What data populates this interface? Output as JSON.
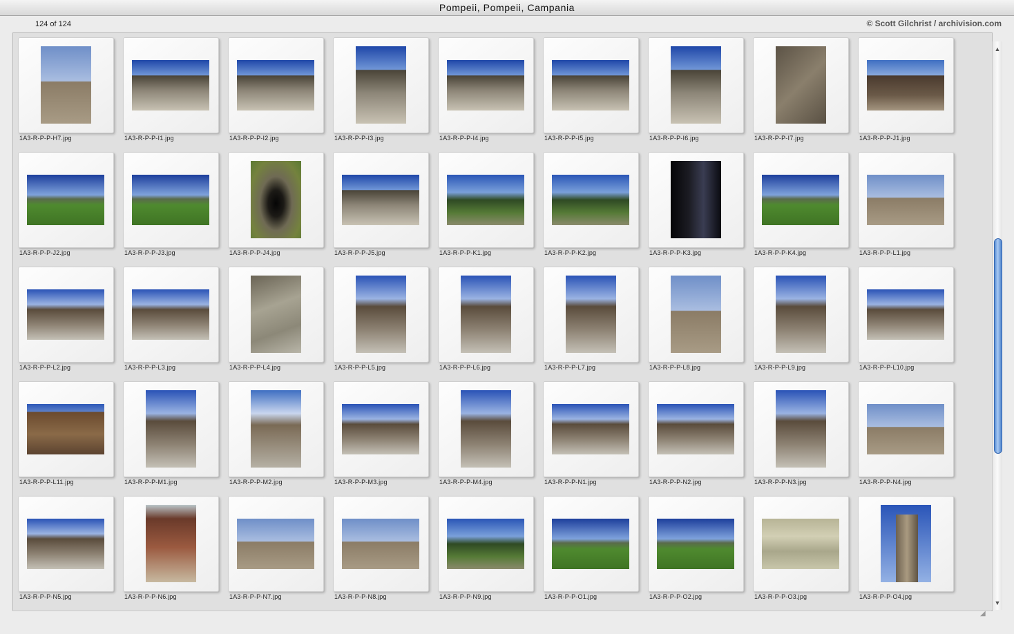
{
  "window": {
    "title": "Pompeii, Pompeii, Campania"
  },
  "info": {
    "count": "124 of 124",
    "copyright": "© Scott Gilchrist / archivision.com"
  },
  "scroll": {
    "up_arrow": "▲",
    "down_arrow": "▼",
    "resize_grip": "◢"
  },
  "colors": {
    "sky": "#2f58b8",
    "stone": "#8a7d6a",
    "grass": "#4f8a2f",
    "shadow": "#1b1b22"
  },
  "thumbnails": [
    {
      "filename": "1A3-R-P-P-H7.jpg",
      "orientation": "portrait",
      "scene": "ruins"
    },
    {
      "filename": "1A3-R-P-P-I1.jpg",
      "orientation": "landscape",
      "scene": "theater"
    },
    {
      "filename": "1A3-R-P-P-I2.jpg",
      "orientation": "landscape",
      "scene": "theater"
    },
    {
      "filename": "1A3-R-P-P-I3.jpg",
      "orientation": "portrait",
      "scene": "theater"
    },
    {
      "filename": "1A3-R-P-P-I4.jpg",
      "orientation": "landscape",
      "scene": "theater"
    },
    {
      "filename": "1A3-R-P-P-I5.jpg",
      "orientation": "landscape",
      "scene": "theater"
    },
    {
      "filename": "1A3-R-P-P-I6.jpg",
      "orientation": "portrait",
      "scene": "theater"
    },
    {
      "filename": "1A3-R-P-P-I7.jpg",
      "orientation": "portrait",
      "scene": "stone"
    },
    {
      "filename": "1A3-R-P-P-J1.jpg",
      "orientation": "landscape",
      "scene": "arches"
    },
    {
      "filename": "1A3-R-P-P-J2.jpg",
      "orientation": "landscape",
      "scene": "field"
    },
    {
      "filename": "1A3-R-P-P-J3.jpg",
      "orientation": "landscape",
      "scene": "field"
    },
    {
      "filename": "1A3-R-P-P-J4.jpg",
      "orientation": "portrait",
      "scene": "tunnel"
    },
    {
      "filename": "1A3-R-P-P-J5.jpg",
      "orientation": "landscape",
      "scene": "theater"
    },
    {
      "filename": "1A3-R-P-P-K1.jpg",
      "orientation": "landscape",
      "scene": "garden"
    },
    {
      "filename": "1A3-R-P-P-K2.jpg",
      "orientation": "landscape",
      "scene": "garden"
    },
    {
      "filename": "1A3-R-P-P-K3.jpg",
      "orientation": "portrait",
      "scene": "dark"
    },
    {
      "filename": "1A3-R-P-P-K4.jpg",
      "orientation": "landscape",
      "scene": "field"
    },
    {
      "filename": "1A3-R-P-P-L1.jpg",
      "orientation": "landscape",
      "scene": "ruins"
    },
    {
      "filename": "1A3-R-P-P-L2.jpg",
      "orientation": "landscape",
      "scene": "street"
    },
    {
      "filename": "1A3-R-P-P-L3.jpg",
      "orientation": "landscape",
      "scene": "street"
    },
    {
      "filename": "1A3-R-P-P-L4.jpg",
      "orientation": "portrait",
      "scene": "paving"
    },
    {
      "filename": "1A3-R-P-P-L5.jpg",
      "orientation": "portrait",
      "scene": "street"
    },
    {
      "filename": "1A3-R-P-P-L6.jpg",
      "orientation": "portrait",
      "scene": "street"
    },
    {
      "filename": "1A3-R-P-P-L7.jpg",
      "orientation": "portrait",
      "scene": "street"
    },
    {
      "filename": "1A3-R-P-P-L8.jpg",
      "orientation": "portrait",
      "scene": "ruins"
    },
    {
      "filename": "1A3-R-P-P-L9.jpg",
      "orientation": "portrait",
      "scene": "street"
    },
    {
      "filename": "1A3-R-P-P-L10.jpg",
      "orientation": "landscape",
      "scene": "street"
    },
    {
      "filename": "1A3-R-P-P-L11.jpg",
      "orientation": "landscape",
      "scene": "wall"
    },
    {
      "filename": "1A3-R-P-P-M1.jpg",
      "orientation": "portrait",
      "scene": "street"
    },
    {
      "filename": "1A3-R-P-P-M2.jpg",
      "orientation": "portrait",
      "scene": "arch"
    },
    {
      "filename": "1A3-R-P-P-M3.jpg",
      "orientation": "landscape",
      "scene": "street"
    },
    {
      "filename": "1A3-R-P-P-M4.jpg",
      "orientation": "portrait",
      "scene": "street"
    },
    {
      "filename": "1A3-R-P-P-N1.jpg",
      "orientation": "landscape",
      "scene": "street"
    },
    {
      "filename": "1A3-R-P-P-N2.jpg",
      "orientation": "landscape",
      "scene": "street"
    },
    {
      "filename": "1A3-R-P-P-N3.jpg",
      "orientation": "portrait",
      "scene": "street"
    },
    {
      "filename": "1A3-R-P-P-N4.jpg",
      "orientation": "landscape",
      "scene": "ruins"
    },
    {
      "filename": "1A3-R-P-P-N5.jpg",
      "orientation": "landscape",
      "scene": "street"
    },
    {
      "filename": "1A3-R-P-P-N6.jpg",
      "orientation": "portrait",
      "scene": "interior"
    },
    {
      "filename": "1A3-R-P-P-N7.jpg",
      "orientation": "landscape",
      "scene": "ruins"
    },
    {
      "filename": "1A3-R-P-P-N8.jpg",
      "orientation": "landscape",
      "scene": "ruins"
    },
    {
      "filename": "1A3-R-P-P-N9.jpg",
      "orientation": "landscape",
      "scene": "garden"
    },
    {
      "filename": "1A3-R-P-P-O1.jpg",
      "orientation": "landscape",
      "scene": "field"
    },
    {
      "filename": "1A3-R-P-P-O2.jpg",
      "orientation": "landscape",
      "scene": "field"
    },
    {
      "filename": "1A3-R-P-P-O3.jpg",
      "orientation": "landscape",
      "scene": "fresco"
    },
    {
      "filename": "1A3-R-P-P-O4.jpg",
      "orientation": "portrait",
      "scene": "column"
    }
  ]
}
